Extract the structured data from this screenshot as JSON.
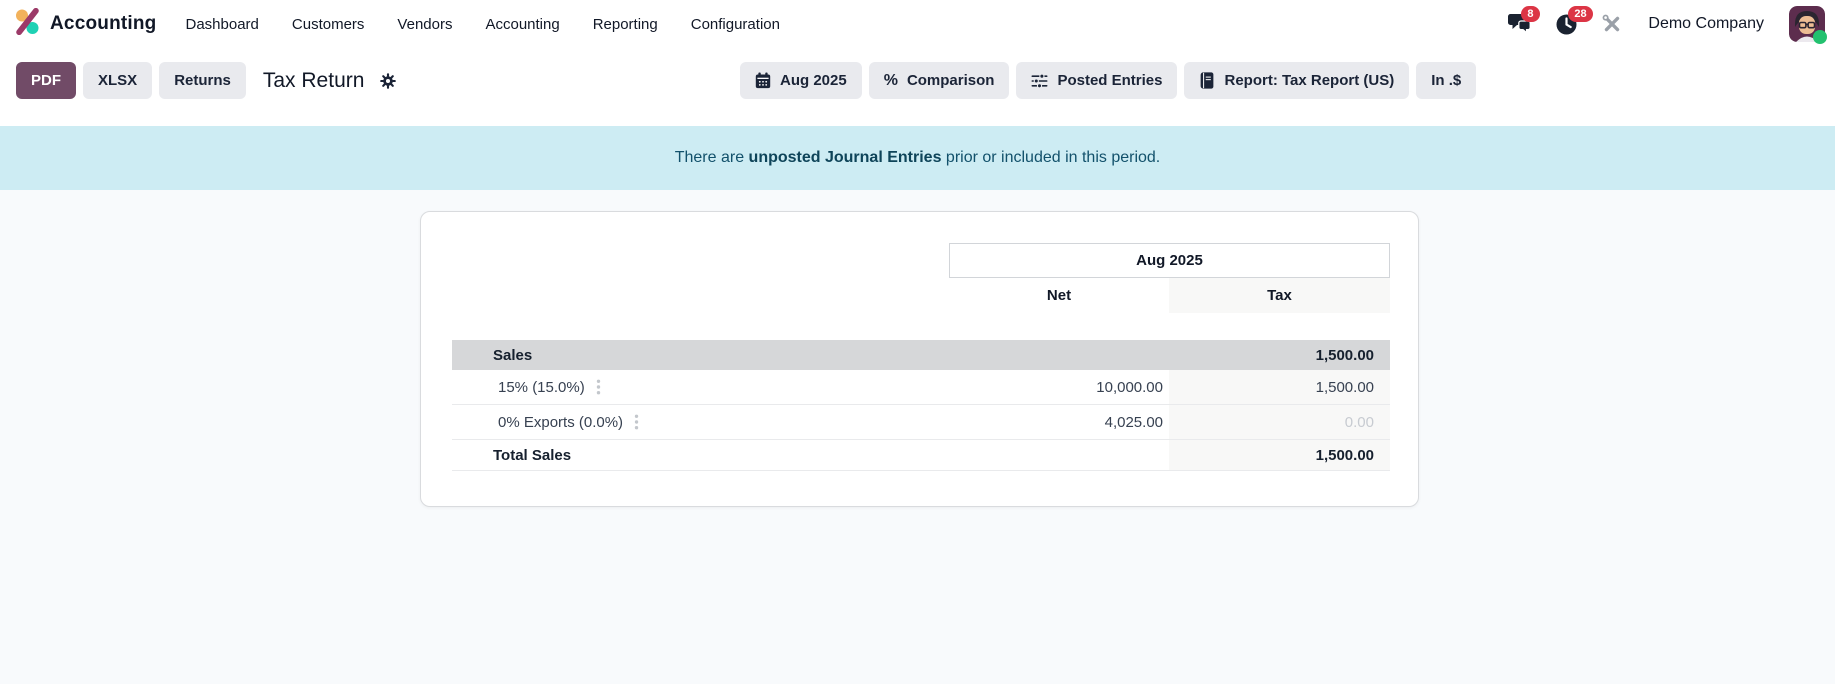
{
  "navbar": {
    "app_name": "Accounting",
    "menu_items": {
      "dashboard": "Dashboard",
      "customers": "Customers",
      "vendors": "Vendors",
      "accounting": "Accounting",
      "reporting": "Reporting",
      "configuration": "Configuration"
    },
    "messages_badge": "8",
    "activities_badge": "28",
    "company_name": "Demo Company"
  },
  "control_panel": {
    "pdf_label": "PDF",
    "xlsx_label": "XLSX",
    "returns_label": "Returns",
    "title": "Tax Return",
    "filters": {
      "period": "Aug 2025",
      "comparison_icon": "%",
      "comparison": "Comparison",
      "posted": "Posted Entries",
      "report": "Report: Tax Report (US)",
      "currency": "In .$"
    }
  },
  "banner": {
    "prefix": "There are ",
    "bold": "unposted Journal Entries",
    "suffix": " prior or included in this period."
  },
  "report_table": {
    "column_header": "Aug 2025",
    "subcolumns": {
      "net": "Net",
      "tax": "Tax"
    },
    "rows": [
      {
        "label": "Sales",
        "net": "",
        "tax": "1,500.00",
        "type": "section"
      },
      {
        "label": "15% (15.0%)",
        "net": "10,000.00",
        "tax": "1,500.00",
        "type": "line"
      },
      {
        "label": "0% Exports (0.0%)",
        "net": "4,025.00",
        "tax": "0.00",
        "type": "line"
      },
      {
        "label": "Total Sales",
        "net": "",
        "tax": "1,500.00",
        "type": "total"
      }
    ]
  },
  "colors": {
    "primary": "#714B67",
    "banner_bg": "#cdecf3",
    "banner_text": "#12516b",
    "badge_red": "#dc3545",
    "online_green": "#23c16f",
    "section_row_bg": "#d6d7d9"
  }
}
